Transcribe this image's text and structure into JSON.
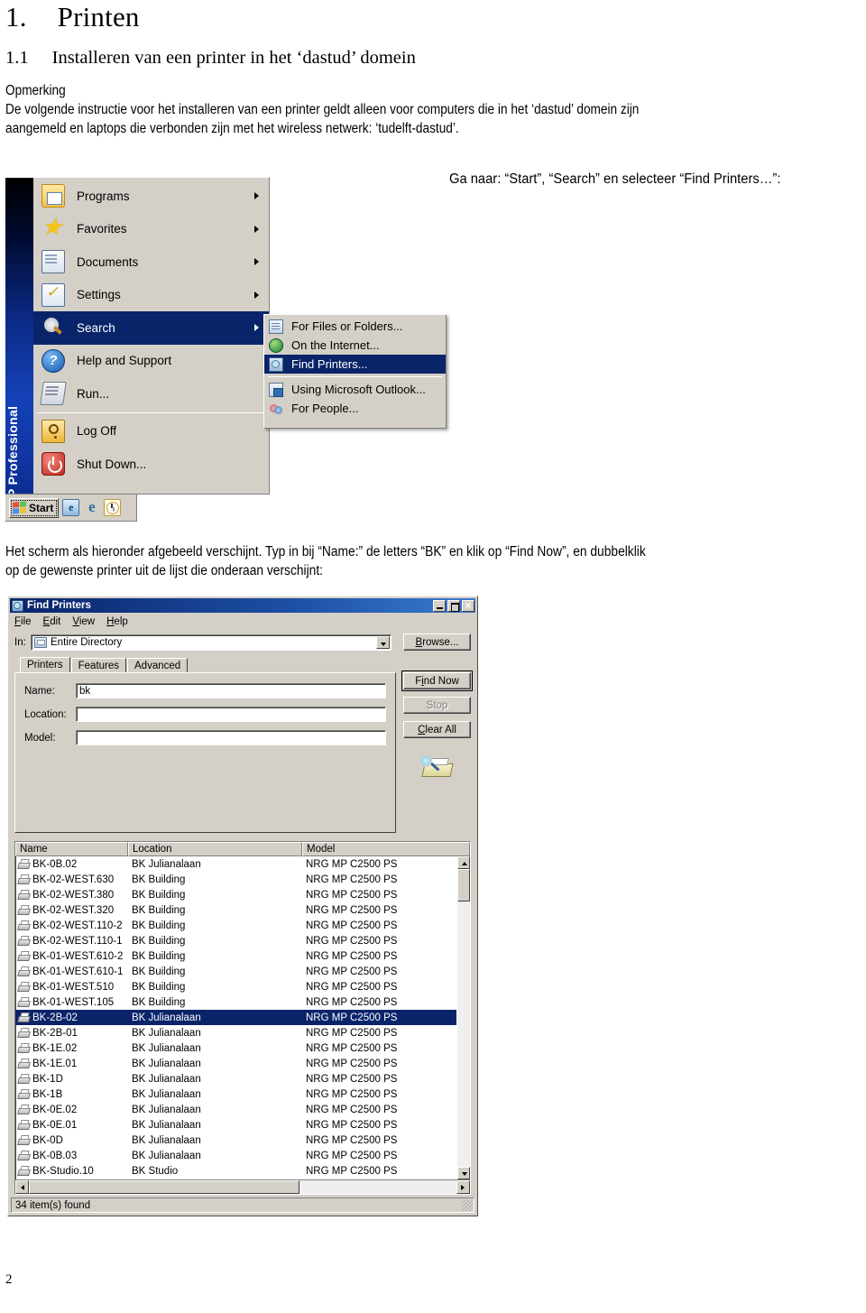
{
  "document": {
    "chapter_number": "1.",
    "chapter_title": "Printen",
    "section_number": "1.1",
    "section_title": "Installeren van een printer in het ‘dastud’ domein",
    "note_heading": "Opmerking",
    "note_line1": "De volgende instructie voor het installeren van een printer geldt alleen voor computers die in het ‘dastud’ domein zijn",
    "note_line2": "aangemeld en laptops die verbonden zijn met het wireless netwerk: ‘tudelft-dastud’.",
    "caption_start": "Ga naar: “Start”, “Search” en selecteer “Find Printers…”:",
    "para2_line1": "Het scherm als hieronder afgebeeld verschijnt. Typ in bij “Name:” de letters “BK” en klik op “Find Now”, en dubbelklik",
    "para2_line2": "op de gewenste printer uit de lijst die onderaan verschijnt:",
    "page_number": "2"
  },
  "start_menu": {
    "banner_text": "Windows XP Professional",
    "items": [
      {
        "label": "Programs",
        "icon": "folder-programs-icon",
        "has_arrow": true,
        "selected": false
      },
      {
        "label": "Favorites",
        "icon": "star-favorites-icon",
        "has_arrow": true,
        "selected": false
      },
      {
        "label": "Documents",
        "icon": "documents-icon",
        "has_arrow": true,
        "selected": false
      },
      {
        "label": "Settings",
        "icon": "settings-icon",
        "has_arrow": true,
        "selected": false
      },
      {
        "label": "Search",
        "icon": "magnifier-search-icon",
        "has_arrow": true,
        "selected": true
      },
      {
        "label": "Help and Support",
        "icon": "help-question-icon",
        "has_arrow": false,
        "selected": false
      },
      {
        "label": "Run...",
        "icon": "run-window-icon",
        "has_arrow": false,
        "selected": false
      },
      {
        "label": "Log Off",
        "icon": "key-logoff-icon",
        "has_arrow": false,
        "selected": false
      },
      {
        "label": "Shut Down...",
        "icon": "power-shutdown-icon",
        "has_arrow": false,
        "selected": false
      }
    ],
    "submenu": [
      {
        "label": "For Files or Folders...",
        "icon": "files-folders-icon",
        "selected": false
      },
      {
        "label": "On the Internet...",
        "icon": "globe-internet-icon",
        "selected": false
      },
      {
        "label": "Find Printers...",
        "icon": "find-printers-icon",
        "selected": true
      },
      {
        "label": "Using Microsoft Outlook...",
        "icon": "outlook-icon",
        "selected": false
      },
      {
        "label": "For People...",
        "icon": "people-icon",
        "selected": false
      }
    ],
    "taskbar": {
      "start_label": "Start",
      "quicklaunch": [
        "show-desktop-icon",
        "internet-explorer-icon",
        "clock-icon"
      ]
    },
    "colors": {
      "selection": "#0a246a",
      "menu_face": "#d4d0c8",
      "banner": "#0b2a86"
    }
  },
  "find_printers": {
    "window_title": "Find Printers",
    "title_icon": "find-printers-window-icon",
    "window_buttons": [
      "minimize",
      "maximize",
      "close"
    ],
    "menus": [
      "File",
      "Edit",
      "View",
      "Help"
    ],
    "in_label": "In:",
    "in_value": "Entire Directory",
    "browse_label": "Browse...",
    "tabs": [
      {
        "label": "Printers",
        "active": true
      },
      {
        "label": "Features",
        "active": false
      },
      {
        "label": "Advanced",
        "active": false
      }
    ],
    "fields": [
      {
        "label": "Name:",
        "value": "bk"
      },
      {
        "label": "Location:",
        "value": ""
      },
      {
        "label": "Model:",
        "value": ""
      }
    ],
    "buttons": [
      {
        "label": "Find Now",
        "state": "default"
      },
      {
        "label": "Stop",
        "state": "disabled"
      },
      {
        "label": "Clear All",
        "state": "normal"
      }
    ],
    "side_glyph": "printer-search-icon",
    "columns": [
      "Name",
      "Location",
      "Model"
    ],
    "rows": [
      {
        "name": "BK-0B.02",
        "location": "BK Julianalaan",
        "model": "NRG MP C2500 PS",
        "selected": false
      },
      {
        "name": "BK-02-WEST.630",
        "location": "BK Building",
        "model": "NRG MP C2500 PS",
        "selected": false
      },
      {
        "name": "BK-02-WEST.380",
        "location": "BK Building",
        "model": "NRG MP C2500 PS",
        "selected": false
      },
      {
        "name": "BK-02-WEST.320",
        "location": "BK Building",
        "model": "NRG MP C2500 PS",
        "selected": false
      },
      {
        "name": "BK-02-WEST.110-2",
        "location": "BK Building",
        "model": "NRG MP C2500 PS",
        "selected": false
      },
      {
        "name": "BK-02-WEST.110-1",
        "location": "BK Building",
        "model": "NRG MP C2500 PS",
        "selected": false
      },
      {
        "name": "BK-01-WEST.610-2",
        "location": "BK Building",
        "model": "NRG MP C2500 PS",
        "selected": false
      },
      {
        "name": "BK-01-WEST.610-1",
        "location": "BK Building",
        "model": "NRG MP C2500 PS",
        "selected": false
      },
      {
        "name": "BK-01-WEST.510",
        "location": "BK Building",
        "model": "NRG MP C2500 PS",
        "selected": false
      },
      {
        "name": "BK-01-WEST.105",
        "location": "BK Building",
        "model": "NRG MP C2500 PS",
        "selected": false
      },
      {
        "name": "BK-2B-02",
        "location": "BK Julianalaan",
        "model": "NRG MP C2500 PS",
        "selected": true
      },
      {
        "name": "BK-2B-01",
        "location": "BK Julianalaan",
        "model": "NRG MP C2500 PS",
        "selected": false
      },
      {
        "name": "BK-1E.02",
        "location": "BK Julianalaan",
        "model": "NRG MP C2500 PS",
        "selected": false
      },
      {
        "name": "BK-1E.01",
        "location": "BK Julianalaan",
        "model": "NRG MP C2500 PS",
        "selected": false
      },
      {
        "name": "BK-1D",
        "location": "BK Julianalaan",
        "model": "NRG MP C2500 PS",
        "selected": false
      },
      {
        "name": "BK-1B",
        "location": "BK Julianalaan",
        "model": "NRG MP C2500 PS",
        "selected": false
      },
      {
        "name": "BK-0E.02",
        "location": "BK Julianalaan",
        "model": "NRG MP C2500 PS",
        "selected": false
      },
      {
        "name": "BK-0E.01",
        "location": "BK Julianalaan",
        "model": "NRG MP C2500 PS",
        "selected": false
      },
      {
        "name": "BK-0D",
        "location": "BK Julianalaan",
        "model": "NRG MP C2500 PS",
        "selected": false
      },
      {
        "name": "BK-0B.03",
        "location": "BK Julianalaan",
        "model": "NRG MP C2500 PS",
        "selected": false
      },
      {
        "name": "BK-Studio.10",
        "location": "BK Studio",
        "model": "NRG MP C2500 PS",
        "selected": false
      }
    ],
    "status_text": "34 item(s) found"
  }
}
